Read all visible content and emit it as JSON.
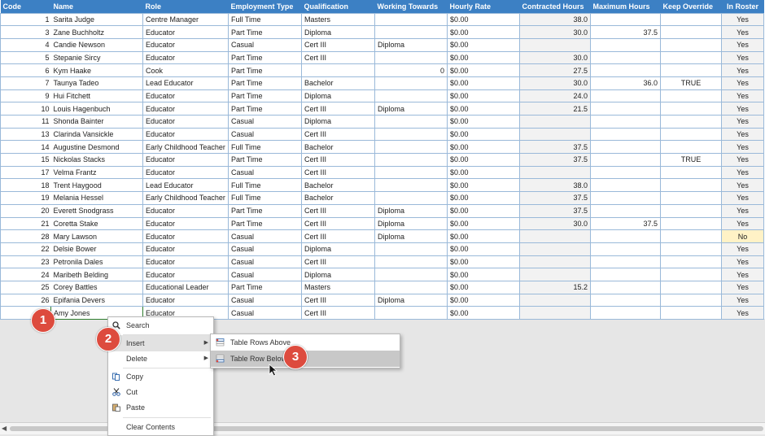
{
  "columns": [
    "Code",
    "Name",
    "Role",
    "Employment Type",
    "Qualification",
    "Working Towards",
    "Hourly Rate",
    "Contracted Hours",
    "Maximum Hours",
    "Keep Override",
    "In Roster"
  ],
  "rows": [
    {
      "code": "1",
      "name": "Sarita Judge",
      "role": "Centre Manager",
      "employment": "Full Time",
      "qualification": "Masters",
      "working": "",
      "rate": "$0.00",
      "contracted": "38.0",
      "maximum": "",
      "override": "",
      "roster": "Yes"
    },
    {
      "code": "3",
      "name": "Zane Buchholtz",
      "role": "Educator",
      "employment": "Part Time",
      "qualification": "Diploma",
      "working": "",
      "rate": "$0.00",
      "contracted": "30.0",
      "maximum": "37.5",
      "override": "",
      "roster": "Yes"
    },
    {
      "code": "4",
      "name": "Candie Newson",
      "role": "Educator",
      "employment": "Casual",
      "qualification": "Cert III",
      "working": "Diploma",
      "rate": "$0.00",
      "contracted": "",
      "maximum": "",
      "override": "",
      "roster": "Yes"
    },
    {
      "code": "5",
      "name": "Stepanie Sircy",
      "role": "Educator",
      "employment": "Part Time",
      "qualification": "Cert III",
      "working": "",
      "rate": "$0.00",
      "contracted": "30.0",
      "maximum": "",
      "override": "",
      "roster": "Yes"
    },
    {
      "code": "6",
      "name": "Kym Haake",
      "role": "Cook",
      "employment": "Part Time",
      "qualification": "",
      "working": "0",
      "rate": "$0.00",
      "contracted": "27.5",
      "maximum": "",
      "override": "",
      "roster": "Yes"
    },
    {
      "code": "7",
      "name": "Taunya Tadeo",
      "role": "Lead Educator",
      "employment": "Part Time",
      "qualification": "Bachelor",
      "working": "",
      "rate": "$0.00",
      "contracted": "30.0",
      "maximum": "36.0",
      "override": "TRUE",
      "roster": "Yes"
    },
    {
      "code": "9",
      "name": "Hui Fitchett",
      "role": "Educator",
      "employment": "Part Time",
      "qualification": "Diploma",
      "working": "",
      "rate": "$0.00",
      "contracted": "24.0",
      "maximum": "",
      "override": "",
      "roster": "Yes"
    },
    {
      "code": "10",
      "name": "Louis Hagenbuch",
      "role": "Educator",
      "employment": "Part Time",
      "qualification": "Cert III",
      "working": "Diploma",
      "rate": "$0.00",
      "contracted": "21.5",
      "maximum": "",
      "override": "",
      "roster": "Yes"
    },
    {
      "code": "11",
      "name": "Shonda Bainter",
      "role": "Educator",
      "employment": "Casual",
      "qualification": "Diploma",
      "working": "",
      "rate": "$0.00",
      "contracted": "",
      "maximum": "",
      "override": "",
      "roster": "Yes"
    },
    {
      "code": "13",
      "name": "Clarinda Vansickle",
      "role": "Educator",
      "employment": "Casual",
      "qualification": "Cert III",
      "working": "",
      "rate": "$0.00",
      "contracted": "",
      "maximum": "",
      "override": "",
      "roster": "Yes"
    },
    {
      "code": "14",
      "name": "Augustine Desmond",
      "role": "Early Childhood Teacher",
      "employment": "Full Time",
      "qualification": "Bachelor",
      "working": "",
      "rate": "$0.00",
      "contracted": "37.5",
      "maximum": "",
      "override": "",
      "roster": "Yes"
    },
    {
      "code": "15",
      "name": "Nickolas Stacks",
      "role": "Educator",
      "employment": "Part Time",
      "qualification": "Cert III",
      "working": "",
      "rate": "$0.00",
      "contracted": "37.5",
      "maximum": "",
      "override": "TRUE",
      "roster": "Yes"
    },
    {
      "code": "17",
      "name": "Velma Frantz",
      "role": "Educator",
      "employment": "Casual",
      "qualification": "Cert III",
      "working": "",
      "rate": "$0.00",
      "contracted": "",
      "maximum": "",
      "override": "",
      "roster": "Yes"
    },
    {
      "code": "18",
      "name": "Trent Haygood",
      "role": "Lead Educator",
      "employment": "Full Time",
      "qualification": "Bachelor",
      "working": "",
      "rate": "$0.00",
      "contracted": "38.0",
      "maximum": "",
      "override": "",
      "roster": "Yes"
    },
    {
      "code": "19",
      "name": "Melania Hessel",
      "role": "Early Childhood Teacher",
      "employment": "Full Time",
      "qualification": "Bachelor",
      "working": "",
      "rate": "$0.00",
      "contracted": "37.5",
      "maximum": "",
      "override": "",
      "roster": "Yes"
    },
    {
      "code": "20",
      "name": "Everett Snodgrass",
      "role": "Educator",
      "employment": "Part Time",
      "qualification": "Cert III",
      "working": "Diploma",
      "rate": "$0.00",
      "contracted": "37.5",
      "maximum": "",
      "override": "",
      "roster": "Yes"
    },
    {
      "code": "21",
      "name": "Coretta Stake",
      "role": "Educator",
      "employment": "Part Time",
      "qualification": "Cert III",
      "working": "Diploma",
      "rate": "$0.00",
      "contracted": "30.0",
      "maximum": "37.5",
      "override": "",
      "roster": "Yes"
    },
    {
      "code": "28",
      "name": "Mary Lawson",
      "role": "Educator",
      "employment": "Casual",
      "qualification": "Cert III",
      "working": "Diploma",
      "rate": "$0.00",
      "contracted": "",
      "maximum": "",
      "override": "",
      "roster": "No"
    },
    {
      "code": "22",
      "name": "Delsie Bower",
      "role": "Educator",
      "employment": "Casual",
      "qualification": "Diploma",
      "working": "",
      "rate": "$0.00",
      "contracted": "",
      "maximum": "",
      "override": "",
      "roster": "Yes"
    },
    {
      "code": "23",
      "name": "Petronila Dales",
      "role": "Educator",
      "employment": "Casual",
      "qualification": "Cert III",
      "working": "",
      "rate": "$0.00",
      "contracted": "",
      "maximum": "",
      "override": "",
      "roster": "Yes"
    },
    {
      "code": "24",
      "name": "Maribeth Belding",
      "role": "Educator",
      "employment": "Casual",
      "qualification": "Diploma",
      "working": "",
      "rate": "$0.00",
      "contracted": "",
      "maximum": "",
      "override": "",
      "roster": "Yes"
    },
    {
      "code": "25",
      "name": "Corey Battles",
      "role": "Educational Leader",
      "employment": "Part Time",
      "qualification": "Masters",
      "working": "",
      "rate": "$0.00",
      "contracted": "15.2",
      "maximum": "",
      "override": "",
      "roster": "Yes"
    },
    {
      "code": "26",
      "name": "Epifania Devers",
      "role": "Educator",
      "employment": "Casual",
      "qualification": "Cert III",
      "working": "Diploma",
      "rate": "$0.00",
      "contracted": "",
      "maximum": "",
      "override": "",
      "roster": "Yes"
    },
    {
      "code": "",
      "name": "Amy Jones",
      "role": "Educator",
      "employment": "Casual",
      "qualification": "Cert III",
      "working": "",
      "rate": "$0.00",
      "contracted": "",
      "maximum": "",
      "override": "",
      "roster": "Yes"
    }
  ],
  "context_menu": {
    "items": [
      {
        "label": "Search",
        "icon": "search-icon"
      },
      {
        "label": "Insert",
        "icon": "",
        "submenu": true
      },
      {
        "label": "Delete",
        "icon": "",
        "submenu": true
      },
      {
        "label": "Copy",
        "icon": "copy-icon"
      },
      {
        "label": "Cut",
        "icon": "cut-icon"
      },
      {
        "label": "Paste",
        "icon": "paste-icon"
      },
      {
        "label": "Clear Contents",
        "icon": ""
      }
    ],
    "submenu_items": [
      {
        "label": "Table Rows Above",
        "icon": "insert-rows-above-icon"
      },
      {
        "label": "Table Row Below",
        "icon": "insert-row-below-icon"
      }
    ]
  },
  "callouts": [
    "1",
    "2",
    "3"
  ],
  "colors": {
    "header": "#3c80c4",
    "callout": "#dd4b3e",
    "roster_no": "#fff2c6"
  }
}
